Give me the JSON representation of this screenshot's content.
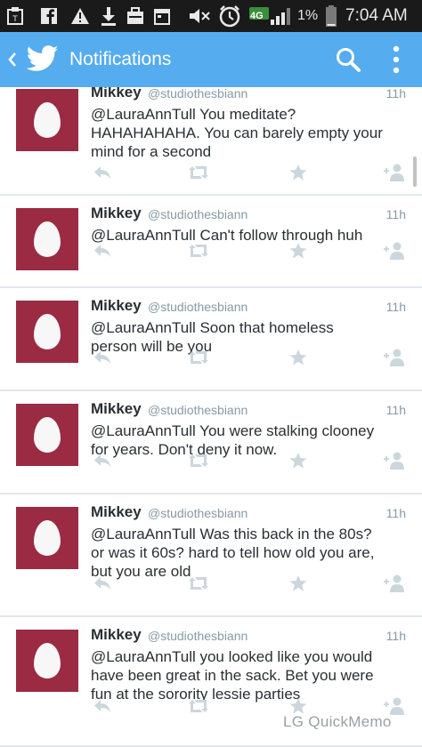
{
  "status_bar": {
    "battery_percent": "1%",
    "clock": "7:04 AM",
    "network": "4G",
    "icons": [
      "app-icon",
      "facebook-icon",
      "warning-icon",
      "download-icon",
      "briefcase-icon",
      "calendar-icon",
      "mute-icon",
      "alarm-icon",
      "signal-icon",
      "battery-icon"
    ]
  },
  "app_bar": {
    "title": "Notifications",
    "back_icon": "chevron-left-icon",
    "logo_icon": "twitter-bird-icon",
    "search_icon": "search-icon",
    "overflow_icon": "more-vertical-icon"
  },
  "tweets": [
    {
      "name": "Mikkey",
      "handle": "@studiothesbiann",
      "time": "11h",
      "lines": [
        "@LauraAnnTull You meditate?",
        "HAHAHAHAHA. You can barely empty your",
        "mind for a second"
      ]
    },
    {
      "name": "Mikkey",
      "handle": "@studiothesbiann",
      "time": "11h",
      "lines": [
        "@LauraAnnTull Can't follow through huh"
      ]
    },
    {
      "name": "Mikkey",
      "handle": "@studiothesbiann",
      "time": "11h",
      "lines": [
        "@LauraAnnTull Soon that homeless",
        "person will be you"
      ]
    },
    {
      "name": "Mikkey",
      "handle": "@studiothesbiann",
      "time": "11h",
      "lines": [
        "@LauraAnnTull You were stalking clooney",
        "for years. Don't deny it now."
      ]
    },
    {
      "name": "Mikkey",
      "handle": "@studiothesbiann",
      "time": "11h",
      "lines": [
        "@LauraAnnTull Was this back in the 80s?",
        "or was it 60s? hard to tell how old you are,",
        "but you are old"
      ]
    },
    {
      "name": "Mikkey",
      "handle": "@studiothesbiann",
      "time": "11h",
      "lines": [
        "@LauraAnnTull you looked like you would",
        "have been great in the sack. Bet you were",
        "fun at the sorority lessie parties"
      ]
    }
  ],
  "actions": [
    "reply-icon",
    "retweet-icon",
    "favorite-icon",
    "follow-icon"
  ],
  "watermark": "LG QuickMemo",
  "colors": {
    "app_bar": "#55acee",
    "status_bar": "#1a1a1a",
    "avatar_bg": "#9b2b42",
    "meta_text": "#8899a6",
    "action_icon": "#ccd6dd"
  }
}
